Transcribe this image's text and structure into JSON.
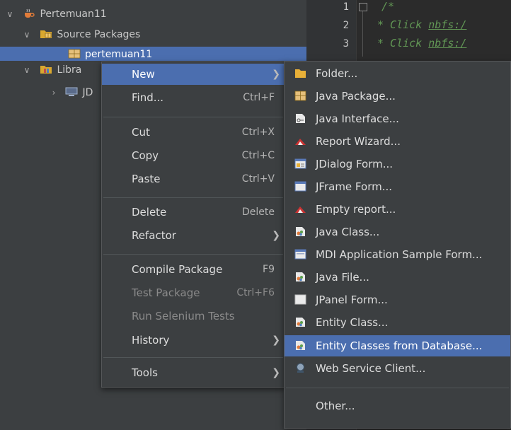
{
  "tree": {
    "items": [
      {
        "label": "Pertemuan11",
        "icon": "coffee-cup-icon"
      },
      {
        "label": "Source Packages",
        "icon": "package-folder-icon"
      },
      {
        "label": "pertemuan11",
        "icon": "package-icon"
      },
      {
        "label": "Libra",
        "icon": "library-folder-icon"
      },
      {
        "label": "JD",
        "icon": "jdk-icon"
      }
    ]
  },
  "editor": {
    "line_numbers": [
      "1",
      "2",
      "3"
    ],
    "lines": [
      {
        "prefix": "/*",
        "link": ""
      },
      {
        "prefix": "* Click ",
        "link": "nbfs:/"
      },
      {
        "prefix": "* Click ",
        "link": "nbfs:/"
      }
    ]
  },
  "context_menu": {
    "items": [
      {
        "label": "New",
        "shortcut": "",
        "submenu": true
      },
      {
        "label": "Find...",
        "shortcut": "Ctrl+F"
      },
      {
        "label": "Cut",
        "shortcut": "Ctrl+X"
      },
      {
        "label": "Copy",
        "shortcut": "Ctrl+C"
      },
      {
        "label": "Paste",
        "shortcut": "Ctrl+V"
      },
      {
        "label": "Delete",
        "shortcut": "Delete"
      },
      {
        "label": "Refactor",
        "shortcut": "",
        "submenu": true
      },
      {
        "label": "Compile Package",
        "shortcut": "F9"
      },
      {
        "label": "Test Package",
        "shortcut": "Ctrl+F6",
        "disabled": true
      },
      {
        "label": "Run Selenium Tests",
        "shortcut": "",
        "disabled": true
      },
      {
        "label": "History",
        "shortcut": "",
        "submenu": true
      },
      {
        "label": "Tools",
        "shortcut": "",
        "submenu": true
      }
    ]
  },
  "new_submenu": {
    "items": [
      {
        "label": "Folder...",
        "icon": "folder-icon"
      },
      {
        "label": "Java Package...",
        "icon": "java-package-icon"
      },
      {
        "label": "Java Interface...",
        "icon": "java-interface-icon"
      },
      {
        "label": "Report Wizard...",
        "icon": "report-wizard-icon"
      },
      {
        "label": "JDialog Form...",
        "icon": "jdialog-form-icon"
      },
      {
        "label": "JFrame Form...",
        "icon": "jframe-form-icon"
      },
      {
        "label": "Empty report...",
        "icon": "empty-report-icon"
      },
      {
        "label": "Java Class...",
        "icon": "java-class-icon"
      },
      {
        "label": "MDI Application Sample Form...",
        "icon": "mdi-form-icon"
      },
      {
        "label": "Java File...",
        "icon": "java-file-icon"
      },
      {
        "label": "JPanel Form...",
        "icon": "jpanel-form-icon"
      },
      {
        "label": "Entity Class...",
        "icon": "entity-class-icon"
      },
      {
        "label": "Entity Classes from Database...",
        "icon": "entity-classes-db-icon"
      },
      {
        "label": "Web Service Client...",
        "icon": "web-service-client-icon"
      },
      {
        "label": "Other...",
        "icon": ""
      }
    ]
  },
  "colors": {
    "selection": "#4b6eaf",
    "menu_bg": "#3c3f41",
    "editor_bg": "#2b2b2b",
    "comment": "#629755"
  }
}
